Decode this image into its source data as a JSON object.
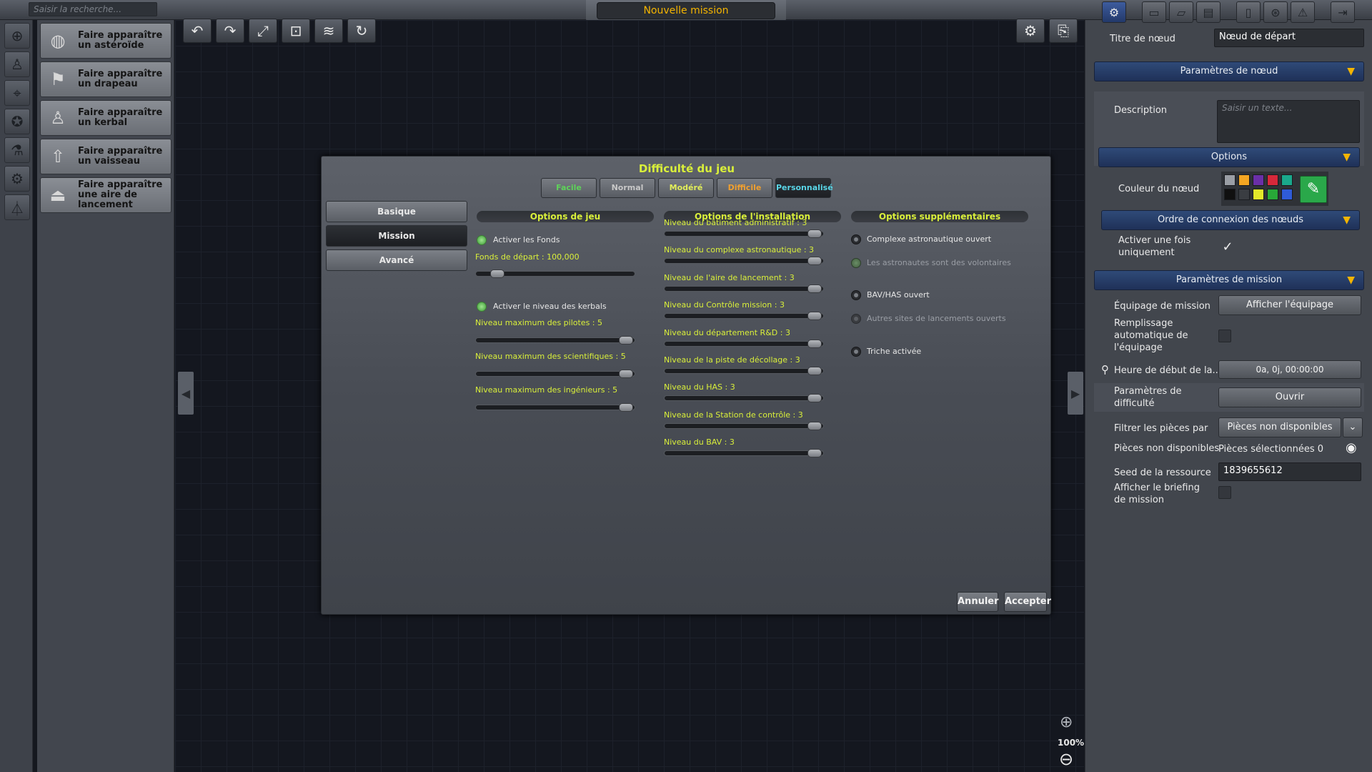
{
  "topbar": {
    "search_placeholder": "Saisir la recherche...",
    "mission_title": "Nouvelle mission"
  },
  "left_icons": [
    "compass-icon",
    "astronaut-icon",
    "location-pin-icon",
    "award-icon",
    "flask-icon",
    "gears-icon",
    "lab-flask-icon"
  ],
  "spawn_items": [
    {
      "label": "Faire apparaître un astéroïde",
      "icon": "asteroid-icon"
    },
    {
      "label": "Faire apparaître un drapeau",
      "icon": "flag-icon"
    },
    {
      "label": "Faire apparaître un kerbal",
      "icon": "kerbal-icon"
    },
    {
      "label": "Faire apparaître un vaisseau",
      "icon": "rocket-icon"
    },
    {
      "label": "Faire apparaître une aire de lancement",
      "icon": "launchpad-icon"
    }
  ],
  "toolbar": {
    "buttons": [
      "undo-icon",
      "redo-icon",
      "expand-icon",
      "fit-icon",
      "layers-icon",
      "refresh-icon"
    ],
    "right_buttons": [
      "settings-icon",
      "inspect-icon"
    ]
  },
  "zoom": {
    "level": "100%"
  },
  "dialog": {
    "title": "Difficulté du jeu",
    "tabs": [
      {
        "label": "Facile",
        "color": "#5fd35a"
      },
      {
        "label": "Normal",
        "color": "#c9c9c9"
      },
      {
        "label": "Modéré",
        "color": "#e2ee5a"
      },
      {
        "label": "Difficile",
        "color": "#f0a030"
      },
      {
        "label": "Personnalisé",
        "color": "#5ad6e8"
      }
    ],
    "selected_tab": "Personnalisé",
    "side_buttons": [
      "Basique",
      "Mission",
      "Avancé"
    ],
    "selected_side": "Mission",
    "col1": {
      "header": "Options de jeu",
      "enable_funds": "Activer les Fonds",
      "starting_funds": "Fonds de départ : 100,000",
      "starting_funds_fraction": 0.1,
      "enable_kerbal_levels": "Activer le niveau des kerbals",
      "pilots": "Niveau maximum des pilotes : 5",
      "scientists": "Niveau maximum des scientifiques : 5",
      "engineers": "Niveau maximum des ingénieurs : 5",
      "level_fraction": 1.0
    },
    "col2": {
      "header": "Options de l'installation",
      "levels": [
        "Niveau du bâtiment administratif : 3",
        "Niveau du complexe astronautique : 3",
        "Niveau de l'aire de lancement : 3",
        "Niveau du Contrôle mission : 3",
        "Niveau du département R&D : 3",
        "Niveau de la piste de décollage : 3",
        "Niveau du HAS : 3",
        "Niveau de la Station de contrôle : 3",
        "Niveau du BAV : 3"
      ],
      "level_fraction": 1.0
    },
    "col3": {
      "header": "Options supplémentaires",
      "astronaut_complex": "Complexe astronautique ouvert",
      "volunteers": "Les astronautes sont des volontaires",
      "vab_sph": "BAV/HAS ouvert",
      "other_sites": "Autres sites de lancements ouverts",
      "cheats": "Triche activée"
    },
    "cancel": "Annuler",
    "accept": "Accepter"
  },
  "right": {
    "top_icons": [
      "mission-builder-icon",
      "folder-icon",
      "folder-open-icon",
      "save-icon",
      "clipboard-icon",
      "satellite-icon",
      "test-icon",
      "exit-icon"
    ],
    "node_title_label": "Titre de nœud",
    "node_title_value": "Nœud de départ",
    "node_params": "Paramètres de nœud",
    "description_label": "Description",
    "description_placeholder": "Saisir un texte...",
    "options": "Options",
    "node_color_label": "Couleur du nœud",
    "swatches": [
      "#9a9ea5",
      "#f4a622",
      "#6a2fa8",
      "#d6283a",
      "#1aa88c",
      "#101010",
      "#3a3d42",
      "#e2e82a",
      "#28a838",
      "#2f5bd8"
    ],
    "connection_order": "Ordre de connexion des nœuds",
    "activate_once_label": "Activer une fois uniquement",
    "mission_params": "Paramètres de mission",
    "crew_label": "Équipage de mission",
    "crew_button": "Afficher l'équipage",
    "autofill_label": "Remplissage automatique de l'équipage",
    "start_time_label": "Heure de début de la...",
    "start_time_value": "0a, 0j, 00:00:00",
    "difficulty_label": "Paramètres de difficulté",
    "difficulty_button": "Ouvrir",
    "filter_label": "Filtrer les pièces par",
    "filter_value": "Pièces non disponibles",
    "unavailable_label": "Pièces non disponibles",
    "unavailable_value": "Pièces sélectionnées 0",
    "seed_label": "Seed de la ressource",
    "seed_value": "1839655612",
    "briefing_label": "Afficher le briefing de mission"
  }
}
